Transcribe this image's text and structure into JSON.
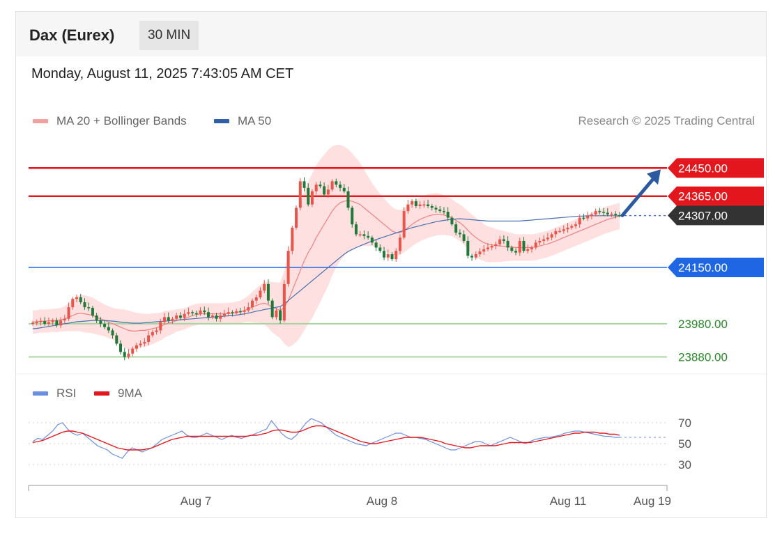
{
  "header": {
    "title": "Dax (Eurex)",
    "timeframe": "30 MIN",
    "datetime": "Monday, August 11, 2025 7:43:05 AM CET"
  },
  "legend": {
    "ma20_label": "MA 20 + Bollinger Bands",
    "ma50_label": "MA 50",
    "credit": "Research © 2025 Trading Central",
    "rsi_label": "RSI",
    "rsi_ma_label": "9MA"
  },
  "colors": {
    "resistance": "#e3161d",
    "support": "#1f66e5",
    "target_green": "#2a8a2a",
    "current": "#333333",
    "candle_up": "#e8554a",
    "candle_down": "#1f7a3a",
    "band_fill": "#ffd6d6",
    "ma20": "#f08080",
    "ma50": "#4a6fb0",
    "rsi": "#6b8fe0",
    "rsi_ma": "#e3161d",
    "arrow": "#2c5aa0"
  },
  "chart_data": [
    {
      "type": "candlestick",
      "title": "Dax (Eurex) 30 MIN",
      "ylim": [
        23860,
        24480
      ],
      "x_ticks": [
        "Aug 7",
        "Aug 8",
        "Aug 11",
        "Aug 19"
      ],
      "levels": [
        {
          "value": 24450.0,
          "label": "24450.00",
          "kind": "resistance"
        },
        {
          "value": 24365.0,
          "label": "24365.00",
          "kind": "resistance"
        },
        {
          "value": 24307.0,
          "label": "24307.00",
          "kind": "current"
        },
        {
          "value": 24150.0,
          "label": "24150.00",
          "kind": "support"
        },
        {
          "value": 23980.0,
          "label": "23980.00",
          "kind": "target"
        },
        {
          "value": 23880.0,
          "label": "23880.00",
          "kind": "target"
        }
      ],
      "closes": [
        23983,
        23985,
        23988,
        23980,
        23985,
        23990,
        23975,
        23990,
        23995,
        24030,
        24055,
        24060,
        24045,
        24030,
        24028,
        24005,
        23990,
        23980,
        23970,
        23960,
        23945,
        23920,
        23895,
        23880,
        23890,
        23905,
        23915,
        23920,
        23925,
        23945,
        23955,
        23960,
        23985,
        24000,
        23990,
        23995,
        24005,
        23998,
        24010,
        24015,
        24012,
        24010,
        24020,
        24015,
        24000,
        24005,
        23995,
        24005,
        24010,
        24015,
        24012,
        24018,
        24016,
        24020,
        24030,
        24050,
        24060,
        24080,
        24100,
        24050,
        24000,
        24020,
        23990,
        24100,
        24200,
        24270,
        24330,
        24410,
        24390,
        24340,
        24380,
        24400,
        24395,
        24370,
        24385,
        24410,
        24400,
        24390,
        24380,
        24330,
        24280,
        24250,
        24250,
        24245,
        24240,
        24225,
        24210,
        24200,
        24180,
        24190,
        24175,
        24200,
        24240,
        24320,
        24340,
        24350,
        24335,
        24340,
        24340,
        24335,
        24330,
        24325,
        24320,
        24318,
        24300,
        24280,
        24255,
        24250,
        24230,
        24185,
        24180,
        24190,
        24198,
        24205,
        24210,
        24215,
        24220,
        24235,
        24230,
        24210,
        24200,
        24195,
        24230,
        24200,
        24205,
        24210,
        24225,
        24230,
        24235,
        24240,
        24250,
        24260,
        24260,
        24265,
        24270,
        24275,
        24280,
        24300,
        24298,
        24305,
        24310,
        24320,
        24318,
        24315,
        24310,
        24312,
        24308,
        24307
      ],
      "ma20": [
        23985,
        23986,
        23988,
        23988,
        23989,
        23990,
        23990,
        23992,
        23995,
        24000,
        24005,
        24010,
        24012,
        24010,
        24008,
        24005,
        24000,
        23995,
        23990,
        23985,
        23980,
        23975,
        23970,
        23965,
        23960,
        23958,
        23958,
        23960,
        23960,
        23962,
        23965,
        23968,
        23972,
        23978,
        23982,
        23985,
        23990,
        23992,
        23995,
        24000,
        24005,
        24008,
        24010,
        24010,
        24010,
        24010,
        24010,
        24010,
        24010,
        24011,
        24012,
        24014,
        24016,
        24020,
        24025,
        24030,
        24035,
        24040,
        24042,
        24038,
        24030,
        24025,
        24020,
        24030,
        24050,
        24080,
        24110,
        24140,
        24170,
        24195,
        24215,
        24240,
        24260,
        24280,
        24300,
        24320,
        24335,
        24345,
        24350,
        24352,
        24350,
        24345,
        24340,
        24330,
        24320,
        24310,
        24300,
        24290,
        24280,
        24270,
        24260,
        24255,
        24255,
        24262,
        24270,
        24280,
        24288,
        24295,
        24300,
        24305,
        24308,
        24310,
        24310,
        24308,
        24305,
        24300,
        24292,
        24285,
        24275,
        24262,
        24250,
        24240,
        24232,
        24225,
        24220,
        24218,
        24216,
        24215,
        24214,
        24213,
        24212,
        24210,
        24210,
        24210,
        24210,
        24210,
        24212,
        24215,
        24218,
        24221,
        24225,
        24230,
        24235,
        24240,
        24245,
        24250,
        24255,
        24260,
        24265,
        24270,
        24275,
        24280,
        24285,
        24290,
        24295,
        24298,
        24302,
        24305
      ],
      "ma50": [
        23965,
        23966,
        23968,
        23970,
        23972,
        23974,
        23976,
        23978,
        23980,
        23982,
        23984,
        23986,
        23987,
        23988,
        23989,
        23990,
        23990,
        23990,
        23990,
        23989,
        23988,
        23987,
        23985,
        23984,
        23983,
        23982,
        23982,
        23982,
        23983,
        23984,
        23985,
        23986,
        23987,
        23988,
        23989,
        23990,
        23991,
        23992,
        23993,
        23994,
        23995,
        23996,
        23997,
        23998,
        23999,
        24000,
        24001,
        24002,
        24003,
        24004,
        24005,
        24006,
        24008,
        24010,
        24012,
        24015,
        24018,
        24020,
        24023,
        24025,
        24027,
        24030,
        24032,
        24040,
        24050,
        24060,
        24070,
        24080,
        24090,
        24100,
        24110,
        24120,
        24130,
        24140,
        24150,
        24160,
        24170,
        24180,
        24190,
        24198,
        24204,
        24210,
        24215,
        24220,
        24225,
        24230,
        24234,
        24238,
        24242,
        24246,
        24250,
        24254,
        24258,
        24262,
        24266,
        24270,
        24273,
        24276,
        24279,
        24282,
        24285,
        24288,
        24290,
        24292,
        24294,
        24295,
        24296,
        24297,
        24296,
        24295,
        24294,
        24293,
        24292,
        24291,
        24290,
        24290,
        24290,
        24290,
        24290,
        24290,
        24290,
        24290,
        24290,
        24291,
        24292,
        24293,
        24294,
        24295,
        24296,
        24297,
        24298,
        24299,
        24300,
        24301,
        24302,
        24303,
        24304,
        24305,
        24305,
        24306,
        24306,
        24306,
        24306,
        24306,
        24306,
        24306,
        24306,
        24306
      ],
      "series_note": "",
      "band_width": [
        35,
        35,
        35,
        35,
        35,
        35,
        36,
        36,
        38,
        42,
        48,
        52,
        55,
        56,
        55,
        54,
        52,
        50,
        48,
        48,
        48,
        50,
        54,
        58,
        60,
        58,
        55,
        52,
        50,
        48,
        46,
        44,
        42,
        40,
        38,
        36,
        34,
        33,
        32,
        32,
        32,
        32,
        32,
        32,
        32,
        32,
        32,
        32,
        32,
        32,
        32,
        33,
        34,
        36,
        40,
        46,
        52,
        58,
        64,
        70,
        76,
        80,
        84,
        110,
        140,
        165,
        185,
        200,
        210,
        215,
        218,
        218,
        215,
        210,
        205,
        195,
        185,
        175,
        165,
        155,
        145,
        135,
        125,
        115,
        105,
        95,
        88,
        82,
        78,
        75,
        72,
        70,
        68,
        66,
        66,
        66,
        66,
        66,
        66,
        66,
        65,
        64,
        62,
        60,
        58,
        56,
        55,
        55,
        56,
        58,
        60,
        60,
        58,
        56,
        54,
        52,
        50,
        48,
        46,
        44,
        42,
        40,
        40,
        40,
        40,
        40,
        40,
        40,
        40,
        40,
        40,
        40,
        40,
        40,
        40,
        40,
        40,
        40,
        40,
        40,
        40,
        40,
        40,
        40,
        40,
        40,
        40,
        40
      ]
    },
    {
      "type": "line",
      "title": "RSI",
      "ylim": [
        20,
        80
      ],
      "y_ticks": [
        70,
        50,
        30
      ],
      "series": [
        {
          "name": "RSI",
          "values": [
            52,
            55,
            54,
            58,
            62,
            68,
            70,
            64,
            60,
            58,
            60,
            56,
            52,
            48,
            46,
            44,
            40,
            38,
            36,
            42,
            46,
            44,
            42,
            44,
            46,
            50,
            54,
            56,
            58,
            60,
            62,
            58,
            56,
            56,
            58,
            60,
            58,
            56,
            54,
            56,
            58,
            56,
            55,
            57,
            58,
            60,
            62,
            64,
            72,
            66,
            60,
            56,
            54,
            58,
            64,
            70,
            74,
            72,
            70,
            66,
            62,
            58,
            56,
            54,
            52,
            50,
            49,
            48,
            50,
            52,
            54,
            56,
            58,
            60,
            60,
            58,
            56,
            56,
            55,
            54,
            52,
            50,
            48,
            46,
            44,
            44,
            46,
            48,
            50,
            52,
            52,
            50,
            48,
            50,
            52,
            54,
            56,
            54,
            52,
            50,
            52,
            54,
            55,
            56,
            56,
            57,
            58,
            60,
            61,
            62,
            62,
            61,
            60,
            59,
            58,
            57,
            57,
            56,
            56
          ]
        },
        {
          "name": "9MA",
          "values": [
            51,
            52,
            53,
            55,
            57,
            59,
            61,
            62,
            62,
            61,
            60,
            58,
            56,
            54,
            52,
            50,
            48,
            46,
            45,
            44,
            44,
            44,
            44,
            45,
            46,
            48,
            50,
            52,
            54,
            55,
            56,
            57,
            57,
            57,
            57,
            57,
            57,
            57,
            57,
            57,
            57,
            57,
            57,
            57,
            58,
            58,
            59,
            60,
            62,
            63,
            63,
            62,
            61,
            61,
            62,
            64,
            66,
            67,
            67,
            66,
            64,
            62,
            60,
            58,
            56,
            54,
            52,
            51,
            50,
            50,
            51,
            52,
            53,
            54,
            55,
            56,
            56,
            56,
            56,
            55,
            54,
            53,
            52,
            50,
            49,
            48,
            47,
            46,
            46,
            47,
            48,
            48,
            48,
            48,
            49,
            50,
            51,
            51,
            51,
            51,
            51,
            52,
            53,
            54,
            55,
            56,
            57,
            58,
            59,
            60,
            60,
            61,
            61,
            61,
            60,
            60,
            59,
            59,
            58
          ]
        }
      ]
    }
  ]
}
